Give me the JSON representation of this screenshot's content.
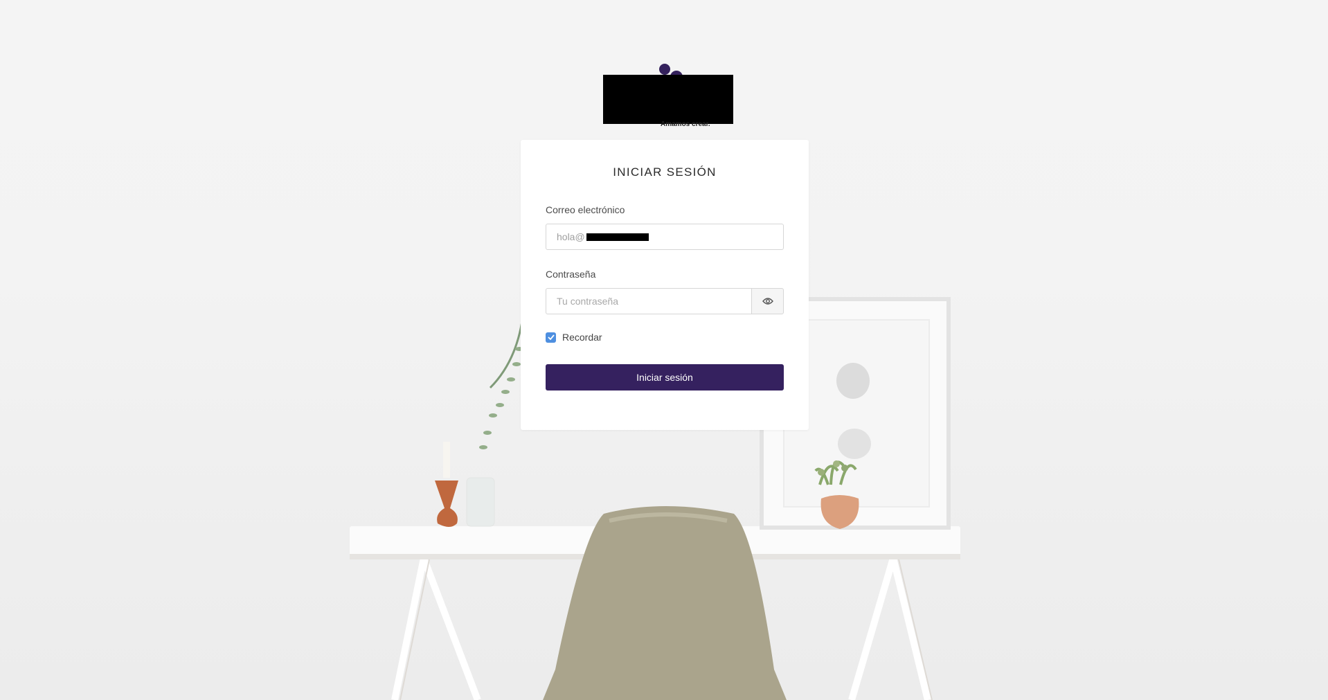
{
  "logo": {
    "tagline": "Amamos crear."
  },
  "login": {
    "title": "INICIAR SESIÓN",
    "email_label": "Correo electrónico",
    "email_value": "hola@",
    "password_label": "Contraseña",
    "password_placeholder": "Tu contraseña",
    "remember_label": "Recordar",
    "remember_checked": true,
    "submit_label": "Iniciar sesión"
  },
  "icons": {
    "toggle_visibility": "eye-icon",
    "checkbox": "check-icon"
  },
  "colors": {
    "brand": "#35215f",
    "checkbox": "#4e8fe0",
    "background": "#f3f3f3"
  }
}
